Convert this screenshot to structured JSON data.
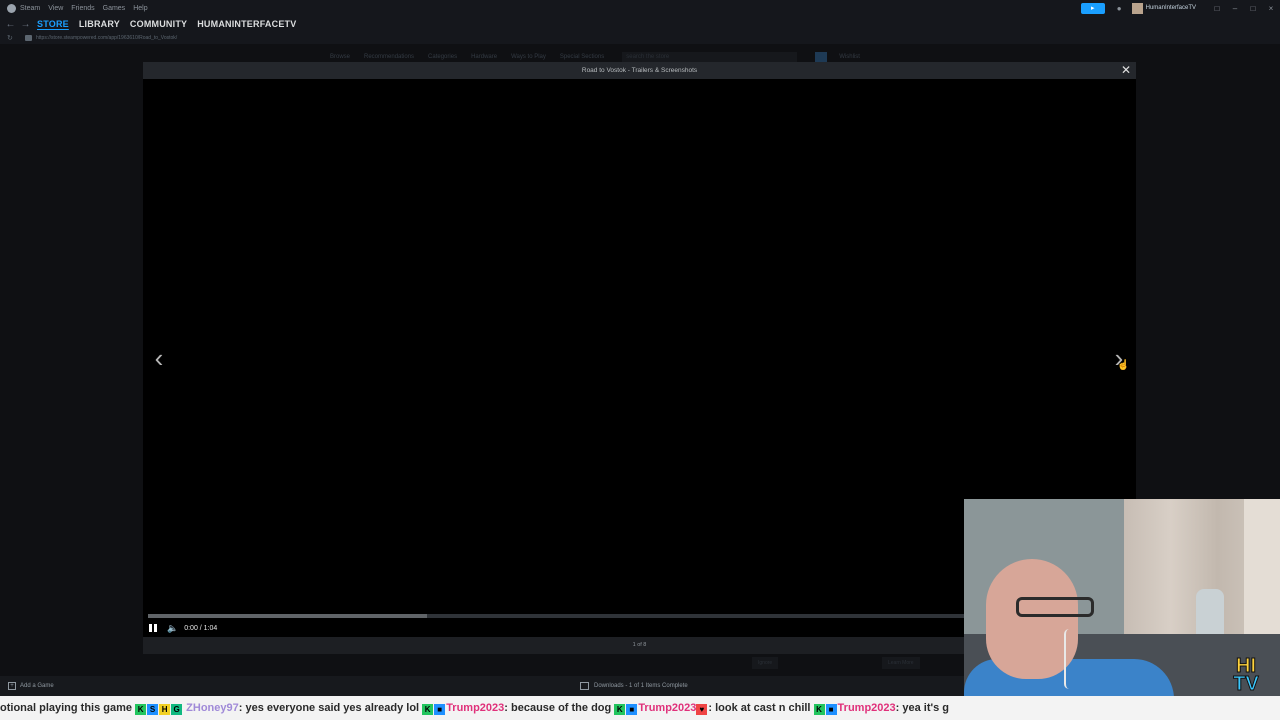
{
  "menubar": {
    "items": [
      "Steam",
      "View",
      "Friends",
      "Games",
      "Help"
    ],
    "username": "HumanInterfaceTV",
    "broadcast_icon": "megaphone-icon",
    "bell_icon": "bell-icon",
    "window_controls": [
      "monitor-icon",
      "minimize-icon",
      "maximize-icon",
      "close-icon"
    ]
  },
  "nav": {
    "tabs": [
      {
        "label": "STORE",
        "active": true
      },
      {
        "label": "LIBRARY",
        "active": false
      },
      {
        "label": "COMMUNITY",
        "active": false
      },
      {
        "label": "HUMANINTERFACETV",
        "active": false
      }
    ],
    "url": "https://store.steampowered.com/app/1963610/Road_to_Vostok/"
  },
  "store_nav": {
    "items": [
      "Browse",
      "Recommendations",
      "Categories",
      "Hardware",
      "Ways to Play",
      "Special Sections"
    ],
    "search_placeholder": "search the store",
    "wishlist": "Wishlist"
  },
  "modal": {
    "title": "Road to Vostok - Trailers & Screenshots",
    "close_icon": "close-icon",
    "prev_icon": "chevron-left-icon",
    "next_icon": "chevron-right-icon",
    "time": "0:00 / 1:04",
    "progress": 0.0,
    "buffered": 0.34,
    "pager": "1 of 8"
  },
  "background_buttons": {
    "ignore": "Ignore",
    "learn_more": "Learn More"
  },
  "statusbar": {
    "add_game": "Add a Game",
    "downloads": "Downloads - 1 of 1 Items Complete"
  },
  "ticker": {
    "part1": "otional playing this game",
    "user1": "ZHoney97",
    "msg1": ": yes everyone said yes already lol",
    "user2": "Trump2023",
    "msg2": ": because of the dog",
    "user3": "Trump2023",
    "msg3": ": look at cast n chill",
    "user4": "Trump2023",
    "msg4": ": yea it's g"
  },
  "overlay_logo": {
    "line1": "HI",
    "line2": "TV"
  }
}
